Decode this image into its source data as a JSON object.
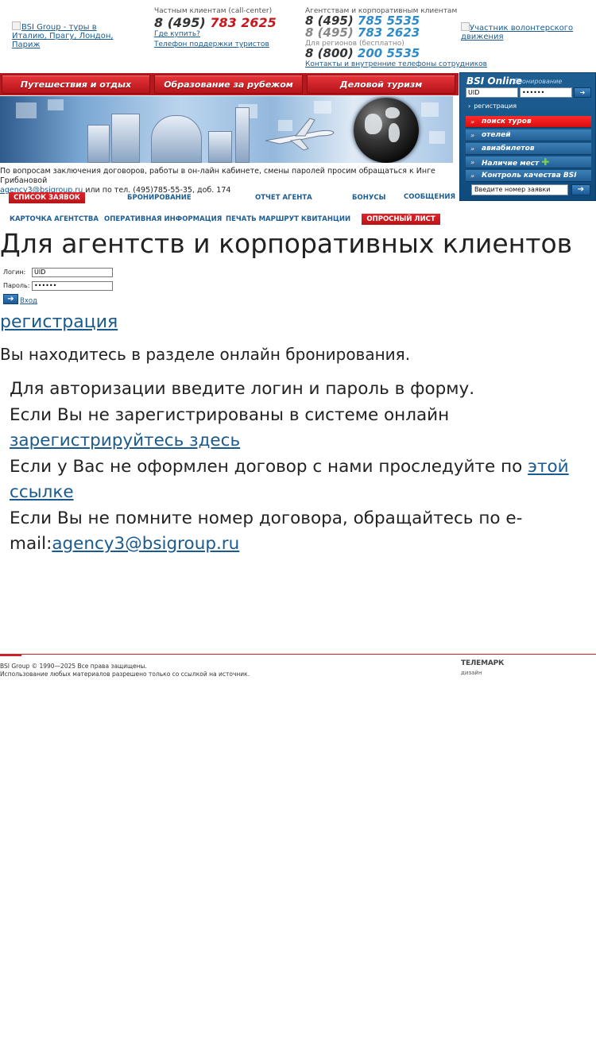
{
  "header": {
    "logo_alt": "BSI Group - туры в Италию, Прагу, Лондон, Париж",
    "private_label": "Частным клиентам (call-center)",
    "private_phone_prefix": "8 (495)",
    "private_phone_number": "783 2625",
    "where_to_buy": "Где купить?",
    "support_phone_link": "Телефон поддержки туристов",
    "agency_label": "Агентствам и корпоративным клиентам",
    "agency_phone1_prefix": "8 (495)",
    "agency_phone1_number": "785 5535",
    "agency_phone2_prefix": "8 (495)",
    "agency_phone2_number": "783 2623",
    "regions_label": "Для регионов (бесплатно)",
    "regions_phone_prefix": "8 (800)",
    "regions_phone_number": "200 5535",
    "contacts_link": "Контакты и внутренние телефоны сотрудников",
    "volunteer_alt": "Участник волонтерского движения"
  },
  "nav": {
    "travel": "Путешествия и отдых",
    "education": "Образование за рубежом",
    "business": "Деловой туризм"
  },
  "online_panel": {
    "title": "BSI Online",
    "subtitle": "бронирование",
    "login_value": "UID",
    "password_value": "••••••",
    "register": "регистрация",
    "items": [
      {
        "label": "поиск туров",
        "active": true
      },
      {
        "label": "отелей",
        "active": false
      },
      {
        "label": "авиабилетов",
        "active": false
      },
      {
        "label": "Наличие мест",
        "active": false
      },
      {
        "label": "Контроль качества BSI",
        "active": false
      }
    ],
    "order_placeholder": "Введите номер заявки"
  },
  "notice": {
    "text": "По вопросам заключения договоров, работы в он-лайн кабинете, смены паролей просим обращаться к Инге Грибановой",
    "email": "agency3@bsigroup.ru",
    "phone_text": "или по тел. (495)785-55-35, доб. 174"
  },
  "agent_menu": {
    "requests": "Список заявок",
    "booking": "Бронирование",
    "agent_report": "Отчет агента",
    "bonuses": "Бонусы",
    "messages": "Сообщения",
    "agency_card": "Карточка агентства",
    "operative_info": "Оперативная информация",
    "print_receipt": "Печать маршрут квитанции",
    "survey": "Опросный лист"
  },
  "main": {
    "title": "Для агентств и корпоративных клиентов",
    "login_label": "Логин:",
    "login_value": "UID",
    "password_label": "Пароль:",
    "password_value": "••••••",
    "enter_link": "Вход",
    "register_link": "регистрация",
    "section_text": "Вы находитесь в разделе онлайн бронирования.",
    "info_line1": "Для авторизации введите логин и пароль в форму.",
    "info_line2_text": "Если Вы не зарегистрированы в системе онлайн ",
    "info_line2_link": "зарегистрируйтесь здесь",
    "info_line3_text": "Если у Вас не оформлен договор с нами проследуйте по ",
    "info_line3_link": "этой ссылке",
    "info_line4_text": "Если Вы не помните номер договора, обращайтесь по e-mail:",
    "info_line4_link": "agency3@bsigroup.ru"
  },
  "footer": {
    "copyright": "BSI Group © 1990—2025 Все права защищены.",
    "usage": "Использование любых материалов разрешено только со ссылкой на источник.",
    "telemark": "ТЕЛЕМАРК",
    "telemark_sub": "дизайн"
  },
  "colors": {
    "brand_red": "#c8161d",
    "brand_blue": "#1d5d92",
    "link_blue": "#1a5a8e"
  }
}
